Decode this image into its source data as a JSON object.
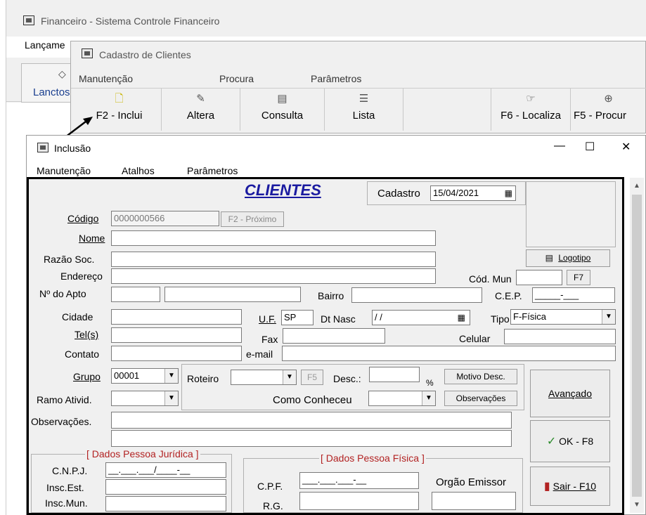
{
  "main_window": {
    "title": "Financeiro - Sistema Controle Financeiro",
    "menu_partial": "Lançame",
    "button_partial": "Lanctos"
  },
  "clientes_window": {
    "title": "Cadastro de Clientes",
    "menu": [
      "Manutenção",
      "Procura",
      "Parâmetros"
    ],
    "toolbar": [
      {
        "label": "F2 - Inclui",
        "icon": "new-doc-icon"
      },
      {
        "label": "Altera",
        "icon": "edit-icon"
      },
      {
        "label": "Consulta",
        "icon": "query-icon"
      },
      {
        "label": "Lista",
        "icon": "list-icon"
      },
      {
        "label": "F6 - Localiza",
        "icon": "locate-icon"
      },
      {
        "label": "F5 - Procur",
        "icon": "zoom-icon"
      }
    ]
  },
  "inclusao_window": {
    "title": "Inclusão",
    "menu": [
      "Manutenção",
      "Atalhos",
      "Parâmetros"
    ],
    "heading": "CLIENTES",
    "cadastro_label": "Cadastro",
    "cadastro_date": "15/04/2021",
    "labels": {
      "codigo": "Código",
      "nome": "Nome",
      "razao": "Razão Soc.",
      "endereco": "Endereço",
      "apto": "Nº  do Apto",
      "bairro": "Bairro",
      "cod_mun": "Cód. Mun",
      "cep": "C.E.P.",
      "cidade": "Cidade",
      "uf": "U.F.",
      "dt_nasc": "Dt Nasc",
      "tipo": "Tipo",
      "tel": "Tel(s)",
      "fax": "Fax",
      "celular": "Celular",
      "contato": "Contato",
      "email": "e-mail",
      "grupo": "Grupo",
      "roteiro": "Roteiro",
      "desc": "Desc.:",
      "percent": "%",
      "ramo": "Ramo Ativid.",
      "como_conheceu": "Como Conheceu",
      "observacoes": "Observações.",
      "pj_section": "[ Dados Pessoa Jurídica ]",
      "pf_section": "[ Dados Pessoa Física ]",
      "cnpj": "C.N.P.J.",
      "insc_est": "Insc.Est.",
      "insc_mun": "Insc.Mun.",
      "cpf": "C.P.F.",
      "rg": "R.G.",
      "orgao": "Orgão Emissor"
    },
    "values": {
      "codigo": "0000000566",
      "uf": "SP",
      "dt_nasc": " / /",
      "tipo": "F-Física",
      "grupo": "00001",
      "cep": "_____-___",
      "cnpj": "__.___.___/____-__",
      "cpf": "___.___.___-__"
    },
    "buttons": {
      "proximo": "F2 - Próximo",
      "logotipo": "Logotipo",
      "f7": "F7",
      "f5": "F5",
      "motivo_desc": "Motivo Desc.",
      "observacoes": "Observações",
      "avancado": "Avançado",
      "ok": "OK - F8",
      "sair": "Sair - F10"
    },
    "window_controls": [
      "—",
      "☐",
      "✕"
    ]
  },
  "colors": {
    "heading": "#1a1aa0",
    "section_title": "#b22222",
    "highlight_border": "#000000"
  }
}
